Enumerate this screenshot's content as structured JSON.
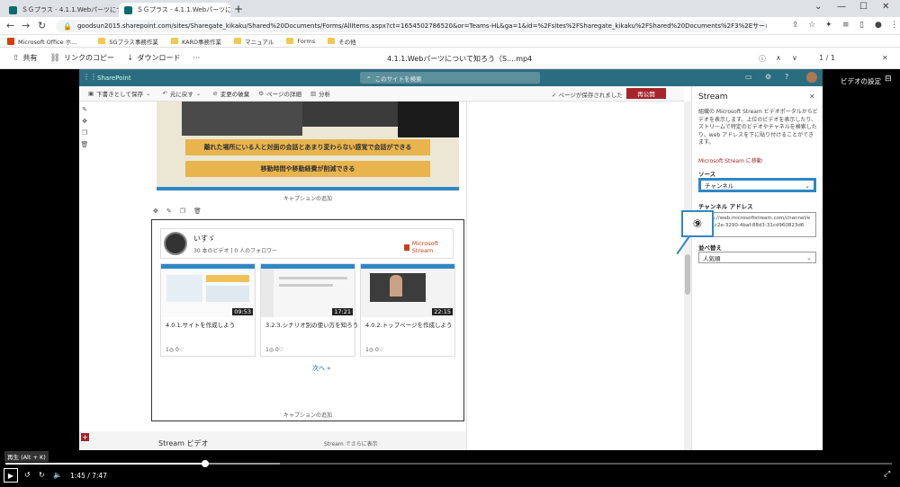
{
  "browser": {
    "tabs": [
      {
        "title": "ＳＧプラス - 4.1.1.Webパーツについ"
      },
      {
        "title": "ＳＧプラス - 4.1.1.Webパーツに"
      }
    ],
    "url": "goodsun2015.sharepoint.com/sites/Sharegate_kikaku/Shared%20Documents/Forms/AllItems.aspx?ct=1654502786520&or=Teams-HL&ga=1&id=%2Fsites%2FSharegate_kikaku%2FShared%20Documents%2F3%2Eサービス資料%2F30%2EMS%20NAVI...",
    "bookmarks": [
      "Microsoft Office ホ...",
      "SGプラス事務作業",
      "KARD事務作業",
      "マニュアル",
      "Forms",
      "その他"
    ]
  },
  "viewer": {
    "commands": [
      "共有",
      "リンクのコピー",
      "ダウンロード",
      "···"
    ],
    "filename": "4.1.1.Webパーツについて知ろう（S....mp4",
    "page": "1 / 1",
    "video_settings": "ビデオの設定"
  },
  "sharepoint": {
    "brand": "SharePoint",
    "search_placeholder": "このサイトを検索",
    "toolbar": [
      "下書きとして保存",
      "元に戻す",
      "変更の破棄",
      "ページの詳細",
      "分析"
    ],
    "saved_status": "ページが保存されました",
    "republish": "再公開",
    "banner1": "離れた場所にいる人と対面の会話とあまり変わらない感覚で会話ができる",
    "banner2": "移動時間や移動経費が削減できる",
    "caption_add": "キャプションの追加",
    "channel": {
      "name": "いすゞ",
      "sub": "30 本のビデオ | 0 人のフォロワー",
      "logo_text": "Microsoft Stream"
    },
    "videos": [
      {
        "title": "4.0.1.サイトを作成しよう",
        "duration": "09:53",
        "stats": "1◎ 0♡"
      },
      {
        "title": "3.2.3.シナリオ別の使い方を知ろう",
        "duration": "17:21",
        "stats": "1◎ 0♡"
      },
      {
        "title": "4.0.2.トップページを作成しよう",
        "duration": "22:15",
        "stats": "1◎ 0♡"
      }
    ],
    "next": "次へ »",
    "bottom_section": "Stream ビデオ",
    "bottom_more": "Stream でさらに表示"
  },
  "panel": {
    "title": "Stream",
    "desc": "組織の Microsoft Stream ビデオポータルからビデオを表示します。上位のビデオを表示したり、ストリームで特定のビデオやチャネルを検索したり、web アドレスを下に貼り付けることができます。",
    "link": "Microsoft Stream に移動",
    "source_label": "ソース",
    "source_value": "チャンネル",
    "address_label": "チャンネル アドレス",
    "address_value": "https://web.microsoftstream.com/channel/eb531c2e-3290-4baf-88d3-31cd960823d6",
    "sort_label": "並べ替え",
    "sort_value": "人気順"
  },
  "callout": "⑨",
  "player": {
    "tooltip": "再生 (Alt + K)",
    "time": "1:45 / 7:47",
    "progress": 0.225,
    "buffered": 0.31
  }
}
